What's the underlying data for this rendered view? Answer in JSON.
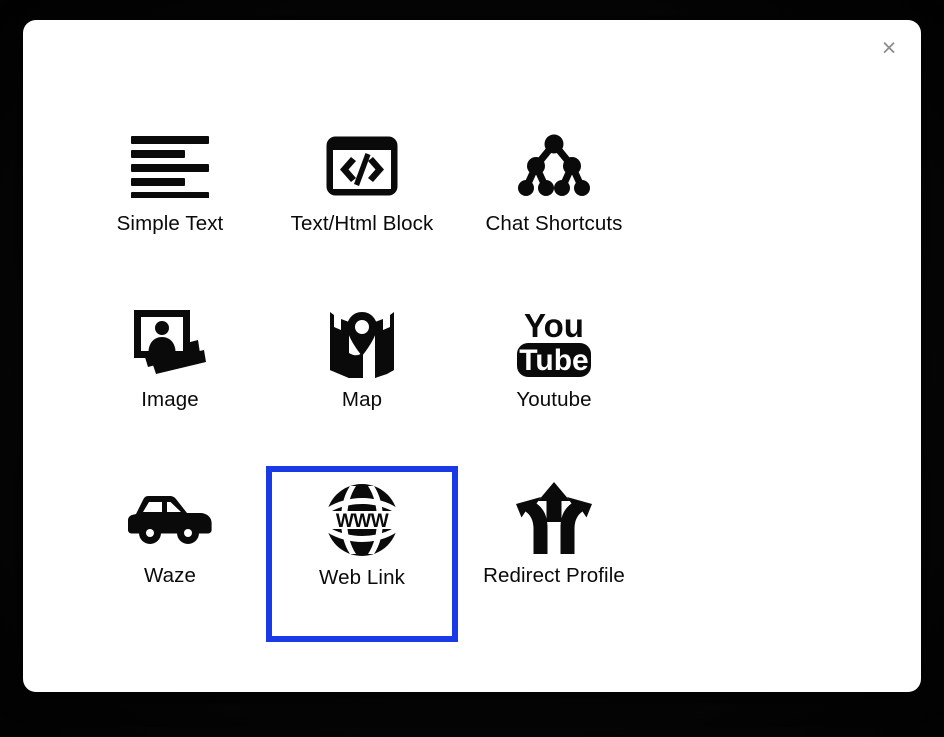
{
  "dialog": {
    "name": "content-block-picker-dialog",
    "close_label": "×",
    "close_icon": "close-icon",
    "background_color": "#ffffff",
    "backdrop_color": "#000000",
    "selection_color": "#1a3ae8"
  },
  "tiles": [
    {
      "id": "simple-text",
      "label": "Simple Text",
      "icon": "text-lines-icon",
      "selected": false
    },
    {
      "id": "text-html-block",
      "label": "Text/Html Block",
      "icon": "code-window-icon",
      "selected": false
    },
    {
      "id": "chat-shortcuts",
      "label": "Chat Shortcuts",
      "icon": "node-tree-icon",
      "selected": false
    },
    {
      "id": "image",
      "label": "Image",
      "icon": "photo-stack-icon",
      "selected": false
    },
    {
      "id": "map",
      "label": "Map",
      "icon": "folded-map-pin-icon",
      "selected": false
    },
    {
      "id": "youtube",
      "label": "Youtube",
      "icon": "youtube-logo-icon",
      "selected": false
    },
    {
      "id": "waze",
      "label": "Waze",
      "icon": "car-icon",
      "selected": false
    },
    {
      "id": "web-link",
      "label": "Web Link",
      "icon": "www-globe-icon",
      "selected": true
    },
    {
      "id": "redirect-profile",
      "label": "Redirect Profile",
      "icon": "three-way-arrows-icon",
      "selected": false
    }
  ]
}
